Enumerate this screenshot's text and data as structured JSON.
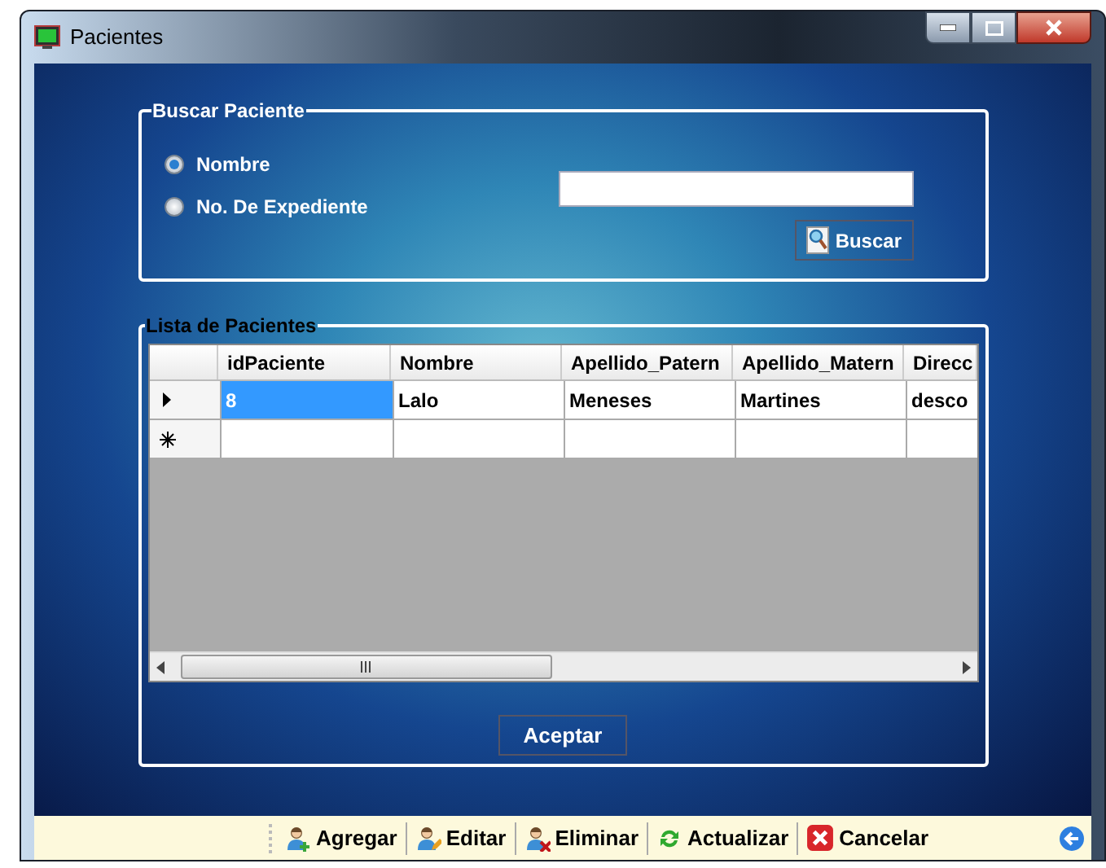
{
  "window": {
    "title": "Pacientes"
  },
  "search_group": {
    "title": "Buscar Paciente",
    "options": [
      {
        "label": "Nombre",
        "selected": true
      },
      {
        "label": "No. De Expediente",
        "selected": false
      }
    ],
    "button": "Buscar"
  },
  "list_group": {
    "title": "Lista de Pacientes",
    "columns": [
      "idPaciente",
      "Nombre",
      "Apellido_Patern",
      "Apellido_Matern",
      "Direcc"
    ],
    "rows": [
      {
        "current": true,
        "cells": [
          {
            "text": "8",
            "selected": true
          },
          {
            "text": "Lalo",
            "selected": false
          },
          {
            "text": "Meneses",
            "selected": false
          },
          {
            "text": "Martines",
            "selected": false
          },
          {
            "text": "desco",
            "selected": false
          }
        ]
      }
    ],
    "new_row": true
  },
  "accept_button": "Aceptar",
  "toolbar": [
    {
      "kind": "add",
      "label": "Agregar"
    },
    {
      "kind": "edit",
      "label": "Editar"
    },
    {
      "kind": "delete",
      "label": "Eliminar"
    },
    {
      "kind": "refresh",
      "label": "Actualizar"
    },
    {
      "kind": "cancel",
      "label": "Cancelar"
    }
  ]
}
